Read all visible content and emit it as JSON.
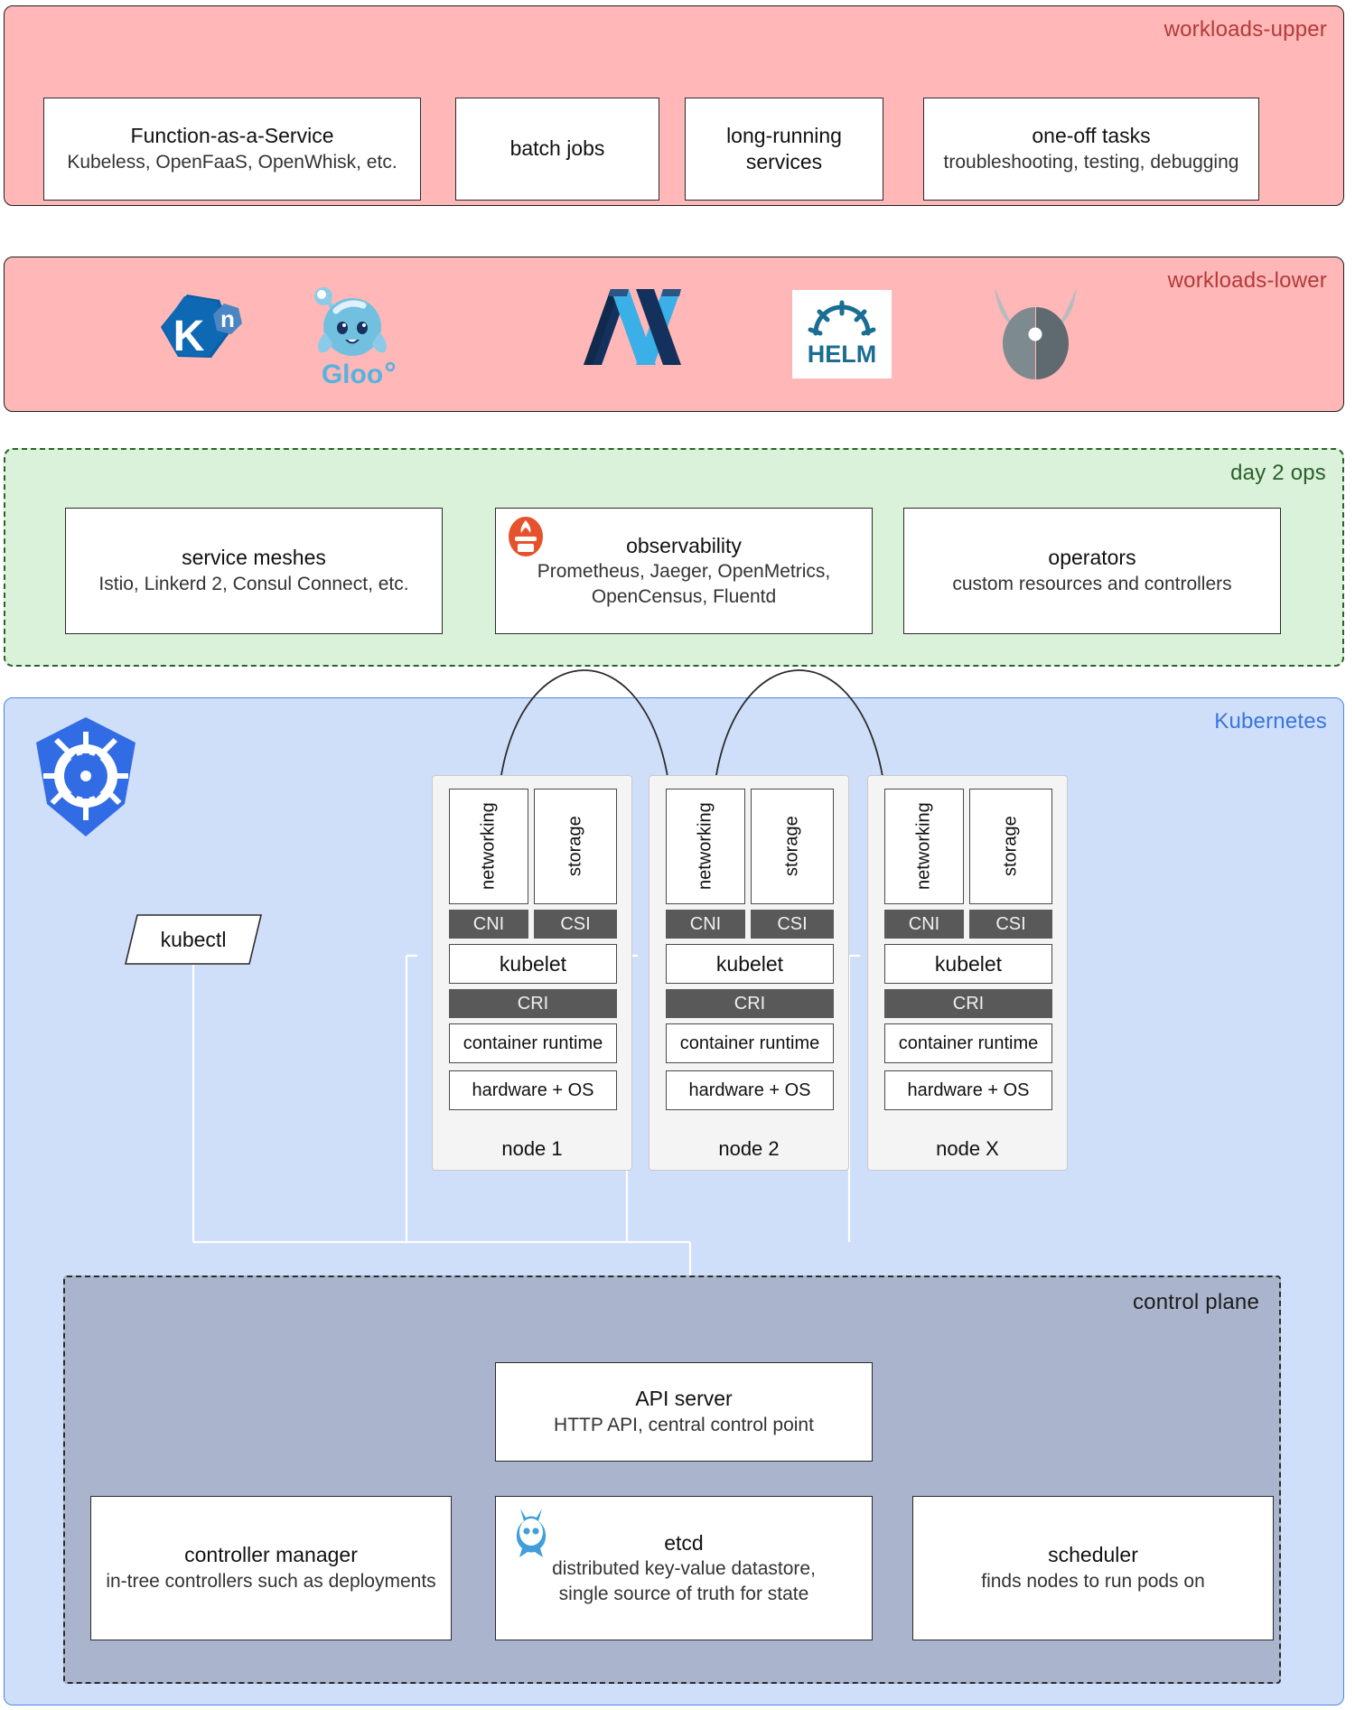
{
  "bands": {
    "workloads_upper": {
      "label": "workloads-upper",
      "color": "#ffb7b7"
    },
    "workloads_lower": {
      "label": "workloads-lower",
      "color": "#ffb7b7"
    },
    "day2ops": {
      "label": "day 2 ops",
      "color": "#d9f2d9"
    },
    "kubernetes": {
      "label": "Kubernetes",
      "color": "#cfdffa"
    },
    "control_plane": {
      "label": "control plane",
      "color": "#aab4cd"
    }
  },
  "workloads_upper": {
    "cards": [
      {
        "title": "Function-as-a-Service",
        "sub": "Kubeless, OpenFaaS, OpenWhisk, etc."
      },
      {
        "title": "batch jobs",
        "sub": ""
      },
      {
        "title": "long-running",
        "sub": "services"
      },
      {
        "title": "one-off tasks",
        "sub": "troubleshooting, testing, debugging"
      }
    ]
  },
  "workloads_lower": {
    "logos": [
      {
        "name": "knative-logo",
        "alt": "Knative"
      },
      {
        "name": "gloo-logo",
        "alt": "Gloo"
      },
      {
        "name": "openfaas-logo",
        "alt": "OpenFaaS"
      },
      {
        "name": "helm-logo",
        "alt": "HELM"
      },
      {
        "name": "kubeless-logo",
        "alt": "Kubeless"
      }
    ],
    "helm_text": "HELM"
  },
  "day2ops": {
    "cards": [
      {
        "title": "service meshes",
        "sub": "Istio, Linkerd 2, Consul Connect, etc.",
        "icon": ""
      },
      {
        "title": "observability",
        "sub": "Prometheus, Jaeger, OpenMetrics,\nOpenCensus, Fluentd",
        "icon": "prometheus-icon"
      },
      {
        "title": "operators",
        "sub": "custom resources and controllers",
        "icon": ""
      }
    ]
  },
  "kubernetes": {
    "logo_name": "kubernetes-logo",
    "kubectl": {
      "label": "kubectl"
    },
    "nodes": [
      {
        "label": "node 1"
      },
      {
        "label": "node 2"
      },
      {
        "label": "node X"
      }
    ],
    "node_layers": {
      "networking": "networking",
      "storage": "storage",
      "cni": "CNI",
      "csi": "CSI",
      "kubelet": "kubelet",
      "cri": "CRI",
      "container_runtime": "container runtime",
      "hardware_os": "hardware + OS"
    }
  },
  "control_plane": {
    "api_server": {
      "title": "API server",
      "sub": "HTTP API, central control point"
    },
    "cards": [
      {
        "title": "controller manager",
        "sub": "in-tree controllers such as deployments",
        "icon": ""
      },
      {
        "title": "etcd",
        "sub": "distributed key-value datastore,\nsingle source of truth for state",
        "icon": "etcd-icon"
      },
      {
        "title": "scheduler",
        "sub": "finds nodes to run pods on",
        "icon": ""
      }
    ]
  },
  "colors": {
    "pink": "#ffb7b7",
    "pink_label": "#b23b3b",
    "green": "#d9f2d9",
    "green_label": "#2c5f2c",
    "blue": "#cfdffa",
    "blue_label": "#3b74dd",
    "control_plane": "#aab4cd",
    "node_bg": "#f4f4f4",
    "dark_layer": "#595959",
    "kubernetes_blue": "#326ce5",
    "prometheus_orange": "#e6522c",
    "etcd_blue": "#419eda"
  }
}
